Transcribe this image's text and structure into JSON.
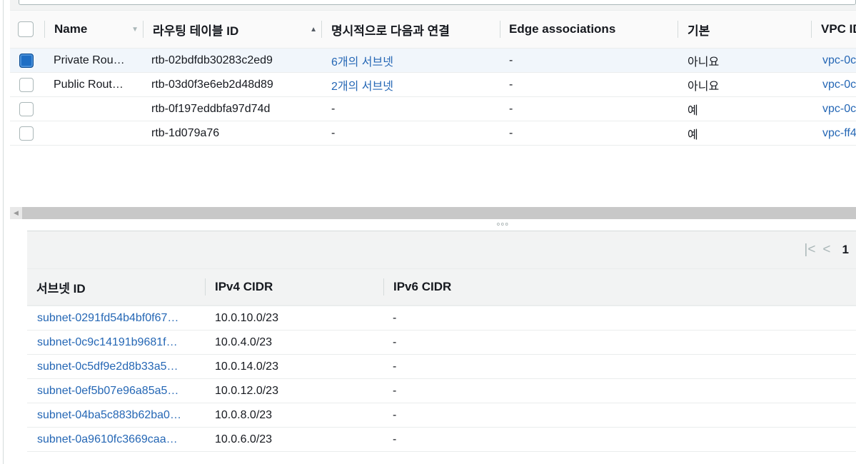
{
  "route_tables": {
    "columns": {
      "name": "Name",
      "route_table_id": "라우팅 테이블 ID",
      "explicit_subnets": "명시적으로 다음과 연결",
      "edge_associations": "Edge associations",
      "main": "기본",
      "vpc_id": "VPC ID"
    },
    "rows": [
      {
        "selected": true,
        "name": "Private Rou…",
        "id": "rtb-02bdfdb30283c2ed9",
        "explicit": "6개의 서브넷",
        "edge": "-",
        "main": "아니요",
        "vpc": "vpc-0c"
      },
      {
        "selected": false,
        "name": "Public Rout…",
        "id": "rtb-03d0f3e6eb2d48d89",
        "explicit": "2개의 서브넷",
        "edge": "-",
        "main": "아니요",
        "vpc": "vpc-0c"
      },
      {
        "selected": false,
        "name": "",
        "id": "rtb-0f197eddbfa97d74d",
        "explicit": "-",
        "edge": "-",
        "main": "예",
        "vpc": "vpc-0c"
      },
      {
        "selected": false,
        "name": "",
        "id": "rtb-1d079a76",
        "explicit": "-",
        "edge": "-",
        "main": "예",
        "vpc": "vpc-ff4"
      }
    ]
  },
  "details": {
    "pager": {
      "first_icon": "first-page-icon",
      "prev_icon": "prev-page-icon",
      "page": "1"
    },
    "columns": {
      "subnet_id": "서브넷 ID",
      "ipv4": "IPv4 CIDR",
      "ipv6": "IPv6 CIDR"
    },
    "rows": [
      {
        "subnet": "subnet-0291fd54b4bf0f67…",
        "ipv4": "10.0.10.0/23",
        "ipv6": "-"
      },
      {
        "subnet": "subnet-0c9c14191b9681f…",
        "ipv4": "10.0.4.0/23",
        "ipv6": "-"
      },
      {
        "subnet": "subnet-0c5df9e2d8b33a5…",
        "ipv4": "10.0.14.0/23",
        "ipv6": "-"
      },
      {
        "subnet": "subnet-0ef5b07e96a85a5…",
        "ipv4": "10.0.12.0/23",
        "ipv6": "-"
      },
      {
        "subnet": "subnet-04ba5c883b62ba0…",
        "ipv4": "10.0.8.0/23",
        "ipv6": "-"
      },
      {
        "subnet": "subnet-0a9610fc3669caa…",
        "ipv4": "10.0.6.0/23",
        "ipv6": "-"
      }
    ]
  },
  "colors": {
    "link": "#2567b5",
    "selected_row": "#f1f6fb",
    "checkbox_checked": "#1e6ec4"
  }
}
